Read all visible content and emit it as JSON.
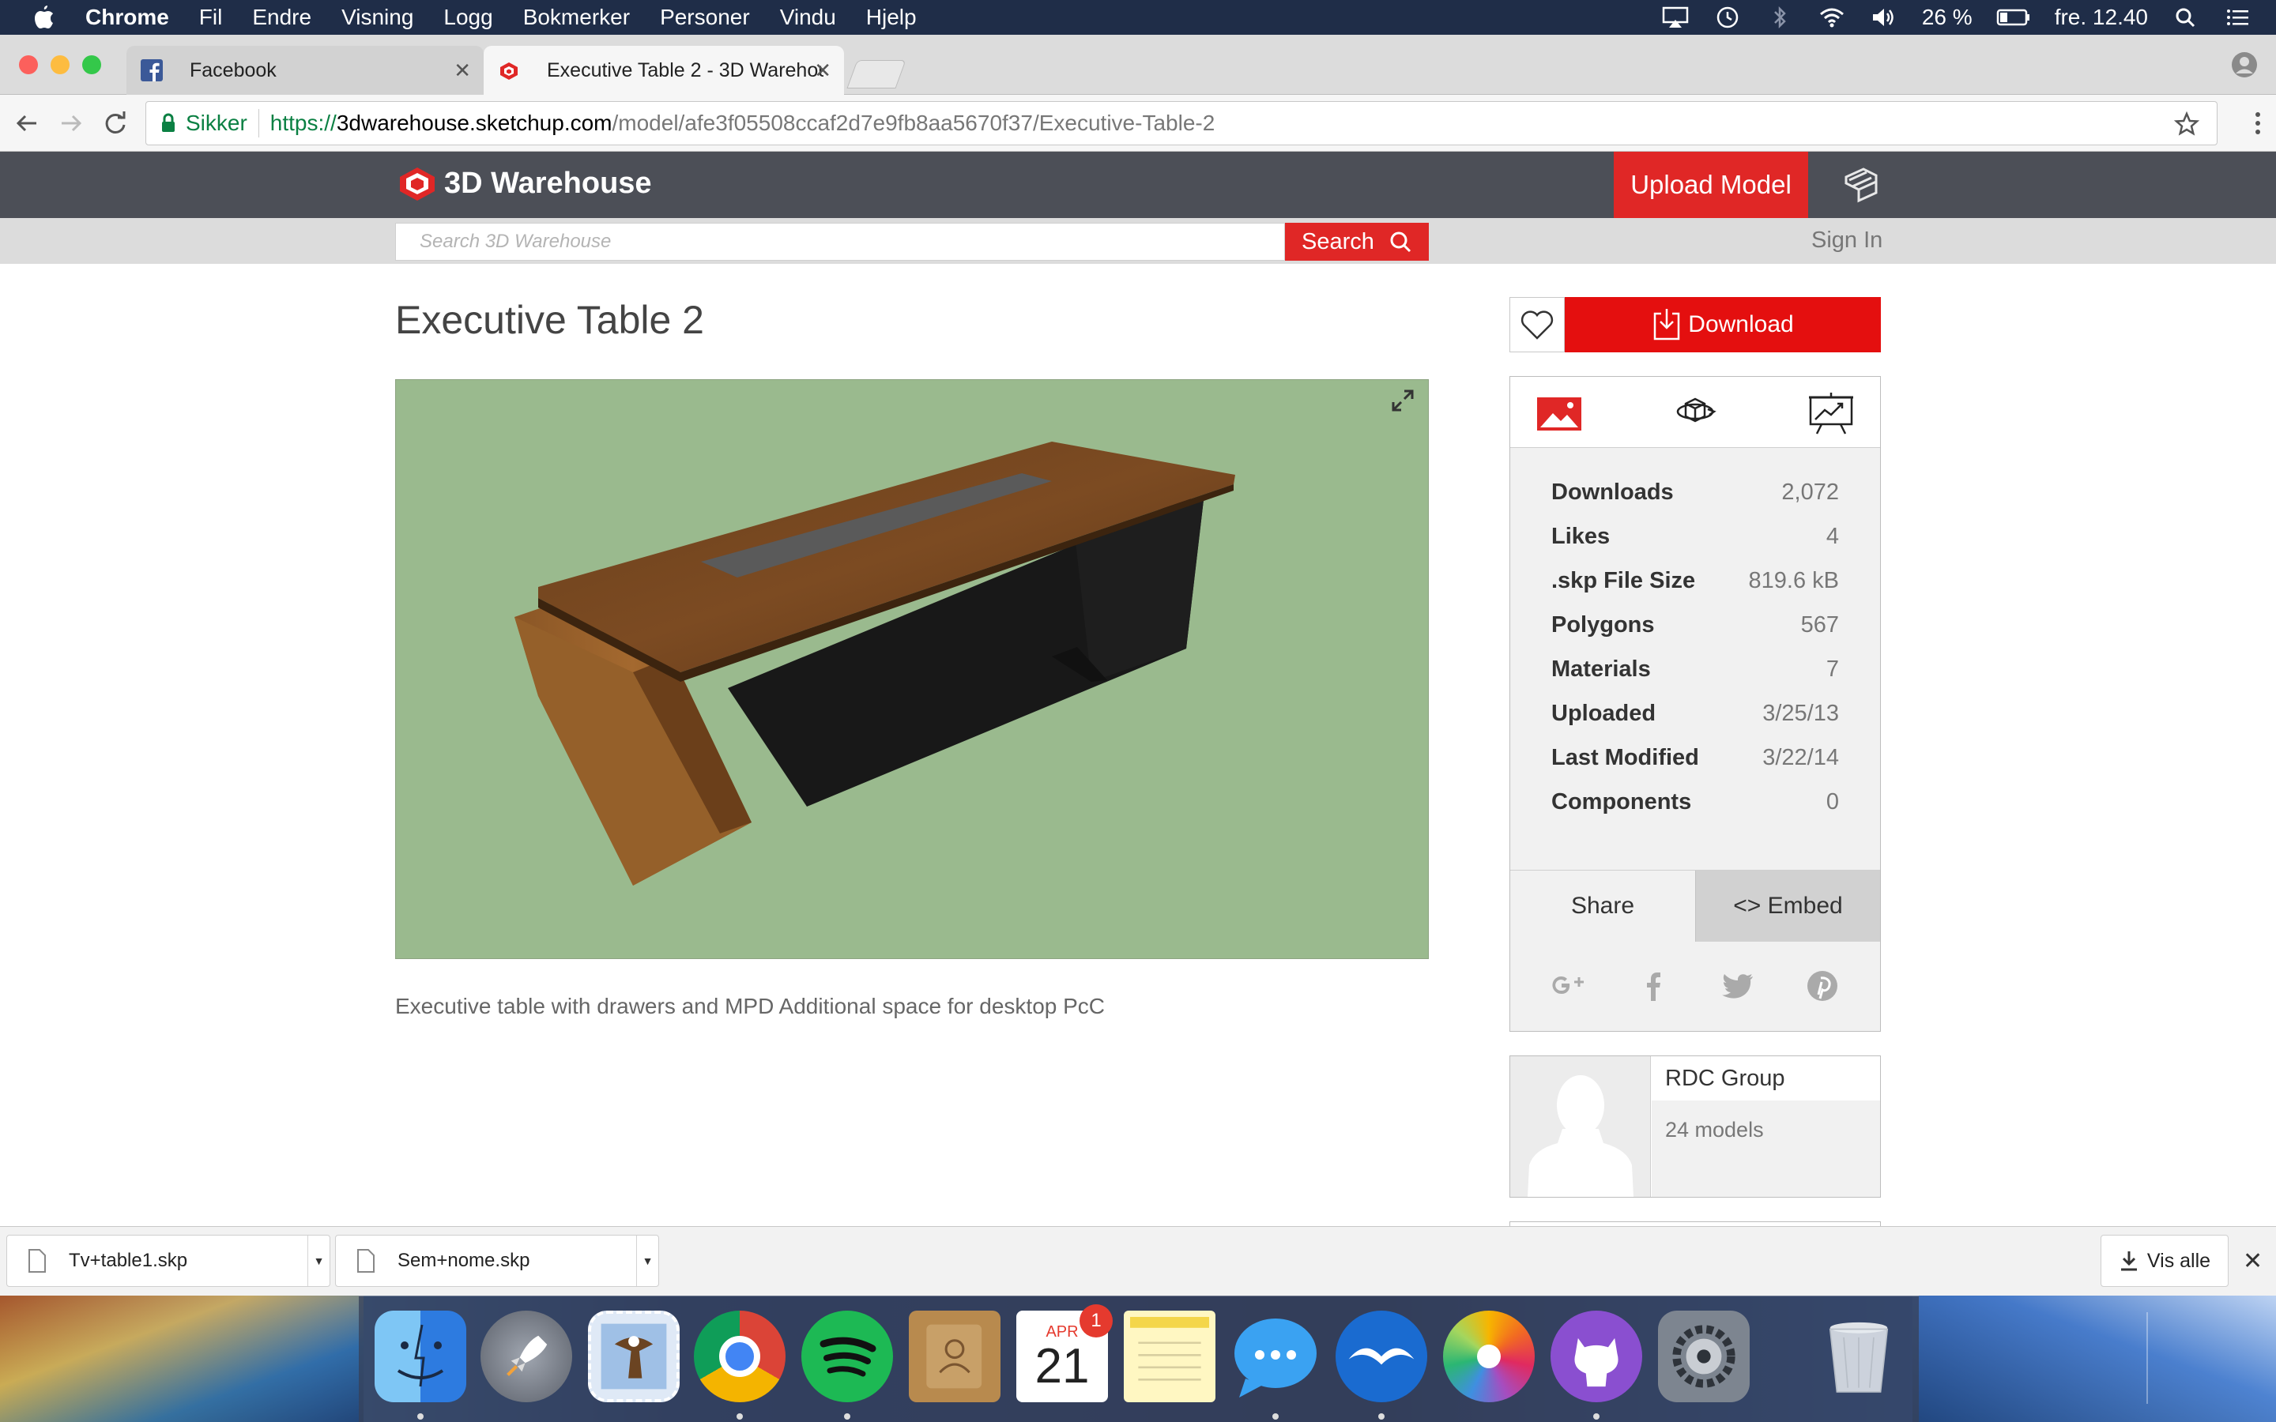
{
  "menubar": {
    "app_name": "Chrome",
    "menus": [
      "Fil",
      "Endre",
      "Visning",
      "Logg",
      "Bokmerker",
      "Personer",
      "Vindu",
      "Hjelp"
    ],
    "battery": "26 %",
    "clock": "fre. 12.40"
  },
  "tabs": [
    {
      "title": "Facebook",
      "icon": "facebook-icon"
    },
    {
      "title": "Executive Table 2 - 3D Warehouse",
      "icon": "sketchup-icon"
    }
  ],
  "address": {
    "secure_label": "Sikker",
    "scheme": "https://",
    "host": "3dwarehouse.sketchup.com",
    "path": "/model/afe3f05508ccaf2d7e9fb8aa5670f37/Executive-Table-2"
  },
  "site": {
    "logo_text": "3D Warehouse",
    "upload_label": "Upload Model",
    "search_placeholder": "Search 3D Warehouse",
    "search_label": "Search",
    "signin_label": "Sign In"
  },
  "model": {
    "title": "Executive Table 2",
    "description": "Executive table with drawers and MPD Additional space for desktop PcC",
    "download_label": "Download",
    "stats": [
      {
        "label": "Downloads",
        "value": "2,072"
      },
      {
        "label": "Likes",
        "value": "4"
      },
      {
        "label": ".skp File Size",
        "value": "819.6 kB"
      },
      {
        "label": "Polygons",
        "value": "567"
      },
      {
        "label": "Materials",
        "value": "7"
      },
      {
        "label": "Uploaded",
        "value": "3/25/13"
      },
      {
        "label": "Last Modified",
        "value": "3/22/14"
      },
      {
        "label": "Components",
        "value": "0"
      }
    ],
    "share_label": "Share",
    "embed_label": "<> Embed"
  },
  "author": {
    "name": "RDC Group",
    "models": "24 models"
  },
  "downloads_shelf": {
    "items": [
      "Tv+table1.skp",
      "Sem+nome.skp"
    ],
    "show_all": "Vis alle"
  },
  "dock": {
    "calendar_month": "APR",
    "calendar_day": "21",
    "calendar_badge": "1"
  },
  "colors": {
    "brand_red": "#e02726",
    "header_gray": "#4c4f57",
    "viewer_bg": "#9aba8e"
  }
}
